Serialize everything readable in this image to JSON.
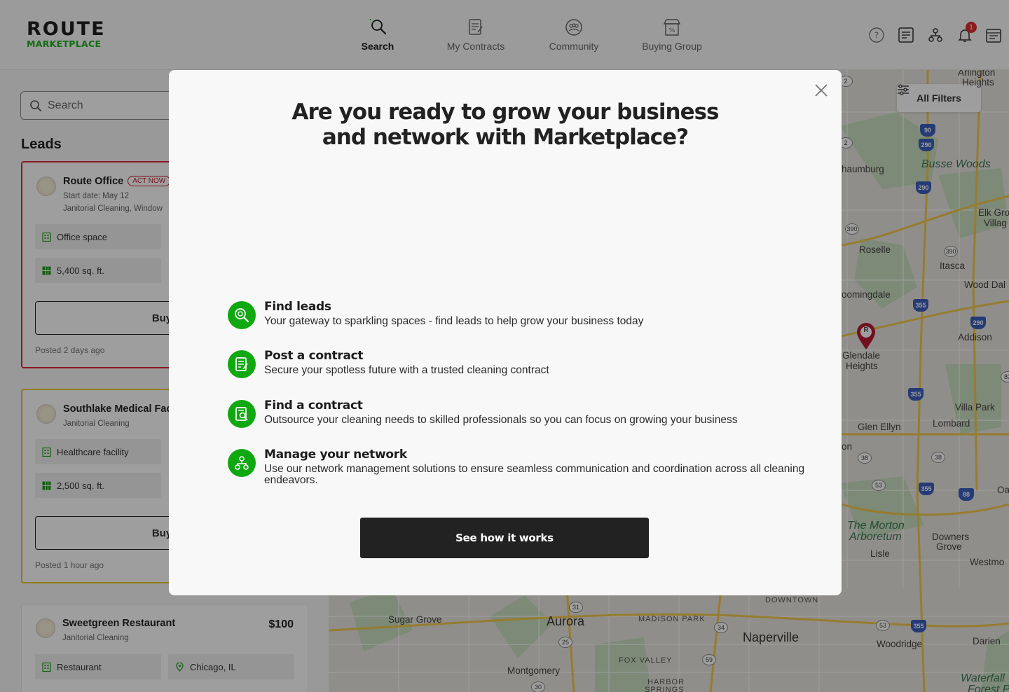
{
  "app": {
    "logo_top": "ROUTE",
    "logo_bottom": "MARKETPLACE"
  },
  "nav": {
    "items": [
      {
        "label": "Search",
        "icon": "search-icon",
        "active": true
      },
      {
        "label": "My Contracts",
        "icon": "contract-icon",
        "active": false
      },
      {
        "label": "Community",
        "icon": "community-icon",
        "active": false
      },
      {
        "label": "Buying Group",
        "icon": "buying-group-icon",
        "active": false
      }
    ]
  },
  "header_icons": {
    "help": "help-icon",
    "list": "list-icon",
    "network": "network-icon",
    "notifications": "bell-icon",
    "notification_count": "1",
    "contracts": "contracts-icon"
  },
  "sidebar": {
    "search_placeholder": "Search",
    "leads_title": "Leads",
    "cards": [
      {
        "title": "Route Office",
        "badge": "ACT NOW",
        "start_date": "Start date: May 12",
        "services": "Janitorial Cleaning, Window",
        "chip_type": "Office space",
        "chip_size": "5,400 sq. ft.",
        "buy_label": "Buy r",
        "posted": "Posted 2 days ago"
      },
      {
        "title": "Southlake Medical Facil",
        "services": "Janitorial Cleaning",
        "chip_type": "Healthcare facility",
        "chip_size": "2,500 sq. ft.",
        "buy_label": "Buy r",
        "posted": "Posted 1 hour ago"
      },
      {
        "title": "Sweetgreen Restaurant",
        "price": "$100",
        "services": "Janitorial Cleaning",
        "chip_type": "Restaurant",
        "chip_location": "Chicago, IL"
      }
    ]
  },
  "map": {
    "all_filters": "All Filters",
    "labels": {
      "arlington": "Arlington",
      "heights": "Heights",
      "busse": "Busse Woods",
      "schaumburg": "haumburg",
      "elk1": "Elk Gro",
      "elk2": "Villag",
      "roselle": "Roselle",
      "itasca": "Itasca",
      "wooddale": "Wood Dal",
      "bloomingdale": "oomingdale",
      "addison": "Addison",
      "glendale1": "Glendale",
      "glendale2": "Heights",
      "villapark": "Villa Park",
      "glenellyn": "Glen Ellyn",
      "lombard": "Lombard",
      "on": "on",
      "morton1": "The Morton",
      "morton2": "Arboretum",
      "downers1": "Downers",
      "downers2": "Grove",
      "lisle": "Lisle",
      "westmont": "Westmo",
      "oa": "Oa",
      "sugargrove": "Sugar Grove",
      "aurora": "Aurora",
      "downtown": "DOWNTOWN",
      "madison": "MADISON PARK",
      "naperville": "Naperville",
      "woodridge": "Woodridge",
      "darien": "Darien",
      "foxvalley": "FOX VALLEY",
      "montgomery": "Montgomery",
      "harbor": "HARBOR",
      "springs": "SPRINGS",
      "waterfall": "Waterfall",
      "forest": "Forest Pr"
    },
    "shields": {
      "s90": "90",
      "s290a": "290",
      "s290b": "290",
      "s390a": "390",
      "s390b": "390",
      "s355a": "355",
      "s290c": "290",
      "s355b": "355",
      "s38a": "38",
      "s38b": "38",
      "s53a": "53",
      "s355c": "355",
      "s88": "88",
      "s31": "31",
      "s25": "25",
      "s34": "34",
      "s53b": "53",
      "s355d": "355",
      "s59": "59",
      "s30": "30",
      "s83": "83",
      "s2a": "2",
      "s2b": "2"
    },
    "pin_letter": "R"
  },
  "modal": {
    "title_line1": "Are you ready to grow your business",
    "title_line2": "and network with Marketplace?",
    "features": [
      {
        "title": "Find leads",
        "desc": "Your gateway to sparkling spaces - find leads to help grow your business today",
        "icon": "find-leads-icon"
      },
      {
        "title": "Post a contract",
        "desc": "Secure your spotless future with a trusted cleaning contract",
        "icon": "post-contract-icon"
      },
      {
        "title": "Find a contract",
        "desc": "Outsource your cleaning needs to skilled professionals so you can focus on growing your business",
        "icon": "find-contract-icon"
      },
      {
        "title": "Manage your network",
        "desc": "Use our network management solutions to ensure seamless communication and coordination across all cleaning endeavors.",
        "icon": "network-icon"
      }
    ],
    "cta_label": "See how it works"
  },
  "colors": {
    "brand_green": "#10a810",
    "act_now_red": "#c41d2c",
    "card_red_border": "#e0283a",
    "card_yellow_border": "#e8c31e",
    "cta_bg": "#222222"
  }
}
